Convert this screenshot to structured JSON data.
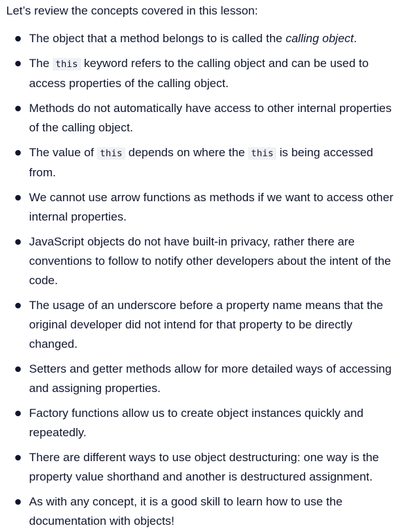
{
  "intro": "Let’s review the concepts covered in this lesson:",
  "items": [
    {
      "a": "The object that a method belongs to is called the ",
      "em": "calling object",
      "b": "."
    },
    {
      "a": "The ",
      "code": "this",
      "b": " keyword refers to the calling object and can be used to access properties of the calling object."
    },
    {
      "text": "Methods do not automatically have access to other internal properties of the calling object."
    },
    {
      "a": "The value of ",
      "code1": "this",
      "b": " depends on where the ",
      "code2": "this",
      "c": " is being accessed from."
    },
    {
      "text": "We cannot use arrow functions as methods if we want to access other internal properties."
    },
    {
      "text": "JavaScript objects do not have built-in privacy, rather there are conventions to follow to notify other developers about the intent of the code."
    },
    {
      "text": "The usage of an underscore before a property name means that the original developer did not intend for that property to be directly changed."
    },
    {
      "text": "Setters and getter methods allow for more detailed ways of accessing and assigning properties."
    },
    {
      "text": "Factory functions allow us to create object instances quickly and repeatedly."
    },
    {
      "text": "There are different ways to use object destructuring: one way is the property value shorthand and another is destructured assignment."
    },
    {
      "text": "As with any concept, it is a good skill to learn how to use the documentation with objects!"
    }
  ]
}
